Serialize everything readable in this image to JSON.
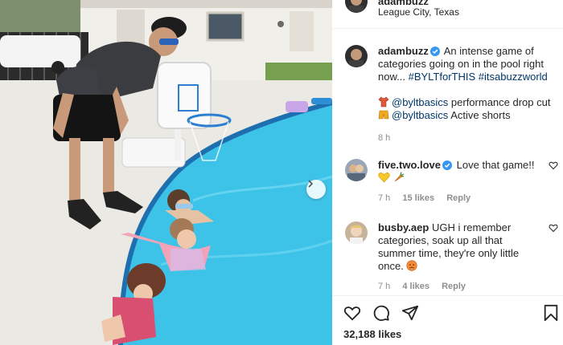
{
  "post": {
    "author": "adambuzz",
    "location": "League City, Texas"
  },
  "caption": {
    "username": "adambuzz",
    "text": "An intense game of categories going on in the pool right now...",
    "hashtags": [
      "#BYLTforTHIS",
      "#itsabuzzworld"
    ],
    "line_shirt": {
      "emoji": "shirt",
      "mention": "@byltbasics",
      "text": "performance drop cut"
    },
    "line_shorts": {
      "emoji": "shorts",
      "mention": "@byltbasics",
      "text": "Active shorts"
    },
    "time": "8 h"
  },
  "comments": [
    {
      "username": "five.two.love",
      "text": "Love that game!!",
      "emojis": [
        "yellow-heart",
        "carrot"
      ],
      "time": "7 h",
      "likes": "15 likes",
      "reply": "Reply"
    },
    {
      "username": "busby.aep",
      "text": "UGH i remember categories, soak up all that summer time, they're only little once.",
      "emojis": [
        "sad-face"
      ],
      "time": "7 h",
      "likes": "4 likes",
      "reply": "Reply"
    }
  ],
  "footer": {
    "likes_count": "32,188 likes"
  },
  "colors": {
    "link": "#00376b",
    "verified": "#3897f0",
    "meta": "#8e8e8e",
    "pool_water": "#3ec3e8"
  },
  "icons": [
    "verified-badge-icon",
    "heart-icon",
    "comment-icon",
    "share-icon",
    "bookmark-icon",
    "chevron-right-icon"
  ]
}
